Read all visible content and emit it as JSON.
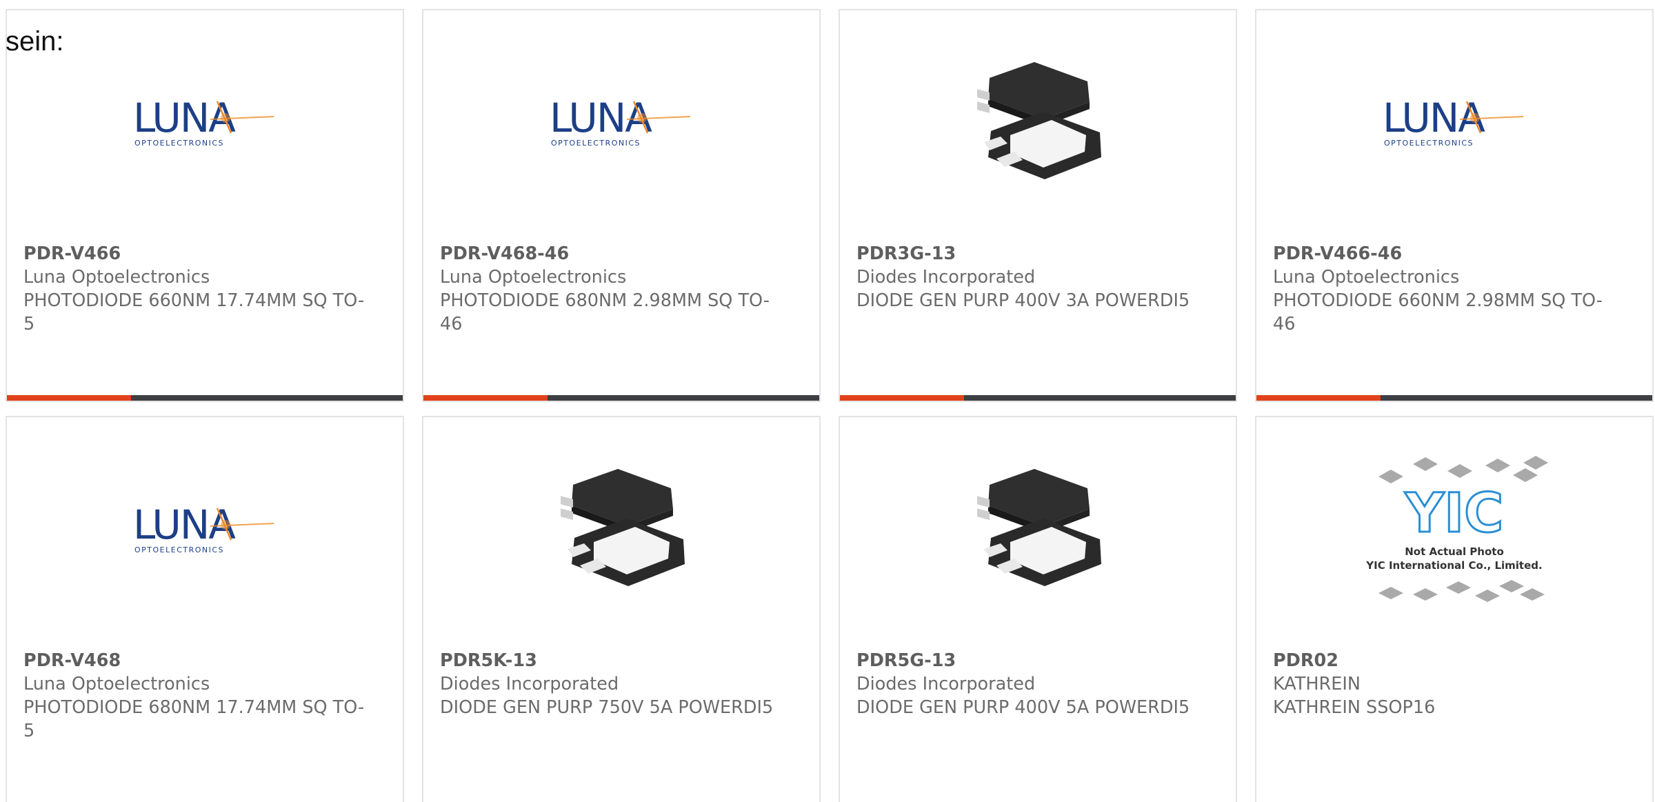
{
  "lead_text": "sein:",
  "colors": {
    "accent": "#e2421b",
    "bar_dark": "#3d3f42",
    "card_border": "#e3e3e3",
    "text_gray": "#6b6b6b",
    "luna_blue": "#1c3f86",
    "luna_orange": "#f08a24",
    "yic_blue": "#2a8fd4"
  },
  "logo_text": {
    "luna_word": "LUNA",
    "luna_tagline": "OPTOELECTRONICS",
    "yic_mark": "YIC",
    "yic_line1": "Not Actual Photo",
    "yic_line2": "YIC International Co., Limited."
  },
  "products": [
    {
      "part_number": "PDR-V466",
      "manufacturer": "Luna Optoelectronics",
      "description": "PHOTODIODE 660NM 17.74MM SQ TO-5",
      "image": "luna-logo",
      "bar_visible": true
    },
    {
      "part_number": "PDR-V468-46",
      "manufacturer": "Luna Optoelectronics",
      "description": "PHOTODIODE 680NM 2.98MM SQ TO-46",
      "image": "luna-logo",
      "bar_visible": true
    },
    {
      "part_number": "PDR3G-13",
      "manufacturer": "Diodes Incorporated",
      "description": "DIODE GEN PURP 400V 3A POWERDI5",
      "image": "powerdi5-package",
      "bar_visible": true
    },
    {
      "part_number": "PDR-V466-46",
      "manufacturer": "Luna Optoelectronics",
      "description": "PHOTODIODE 660NM 2.98MM SQ TO-46",
      "image": "luna-logo",
      "bar_visible": true
    },
    {
      "part_number": "PDR-V468",
      "manufacturer": "Luna Optoelectronics",
      "description": "PHOTODIODE 680NM 17.74MM SQ TO-5",
      "image": "luna-logo",
      "bar_visible": false
    },
    {
      "part_number": "PDR5K-13",
      "manufacturer": "Diodes Incorporated",
      "description": "DIODE GEN PURP 750V 5A POWERDI5",
      "image": "powerdi5-package",
      "bar_visible": false
    },
    {
      "part_number": "PDR5G-13",
      "manufacturer": "Diodes Incorporated",
      "description": "DIODE GEN PURP 400V 5A POWERDI5",
      "image": "powerdi5-package",
      "bar_visible": false
    },
    {
      "part_number": "PDR02",
      "manufacturer": "KATHREIN",
      "description": "KATHREIN SSOP16",
      "image": "yic-placeholder",
      "bar_visible": false
    }
  ]
}
